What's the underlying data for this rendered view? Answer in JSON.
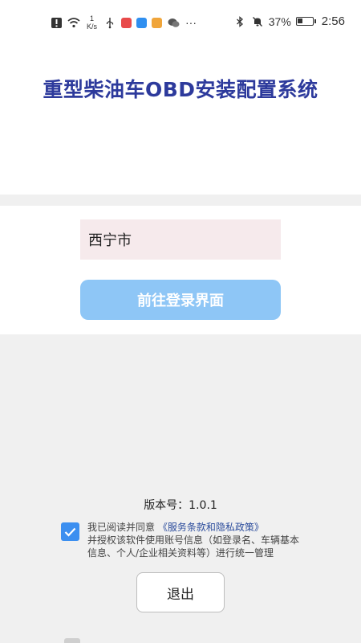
{
  "status_bar": {
    "net_speed_value": "1",
    "net_speed_unit": "K/s",
    "battery_percent": "37%",
    "battery_level": 0.37,
    "time": "2:56"
  },
  "header": {
    "title": "重型柴油车OBD安装配置系统"
  },
  "form": {
    "city_value": "西宁市",
    "login_button_label": "前往登录界面"
  },
  "footer": {
    "version_text": "版本号：1.0.1",
    "agreement_prefix": "我已阅读并同意",
    "policy_link": "《服务条款和隐私政策》",
    "agreement_body": "并授权该软件使用账号信息（如登录名、车辆基本信息、个人/企业相关资料等）进行统一管理",
    "checkbox_checked": true,
    "exit_button_label": "退出"
  },
  "icons": {
    "alert": "alert-icon",
    "wifi": "wifi-icon",
    "usb": "usb-icon",
    "bluetooth": "bluetooth-icon",
    "mute": "bell-off-icon",
    "battery": "battery-icon"
  },
  "colors": {
    "title": "#2d3a9c",
    "login_button": "#8ec6f6",
    "input_bg": "#f6eaec",
    "checkbox": "#3c8ff0",
    "link": "#2b4c9c"
  }
}
